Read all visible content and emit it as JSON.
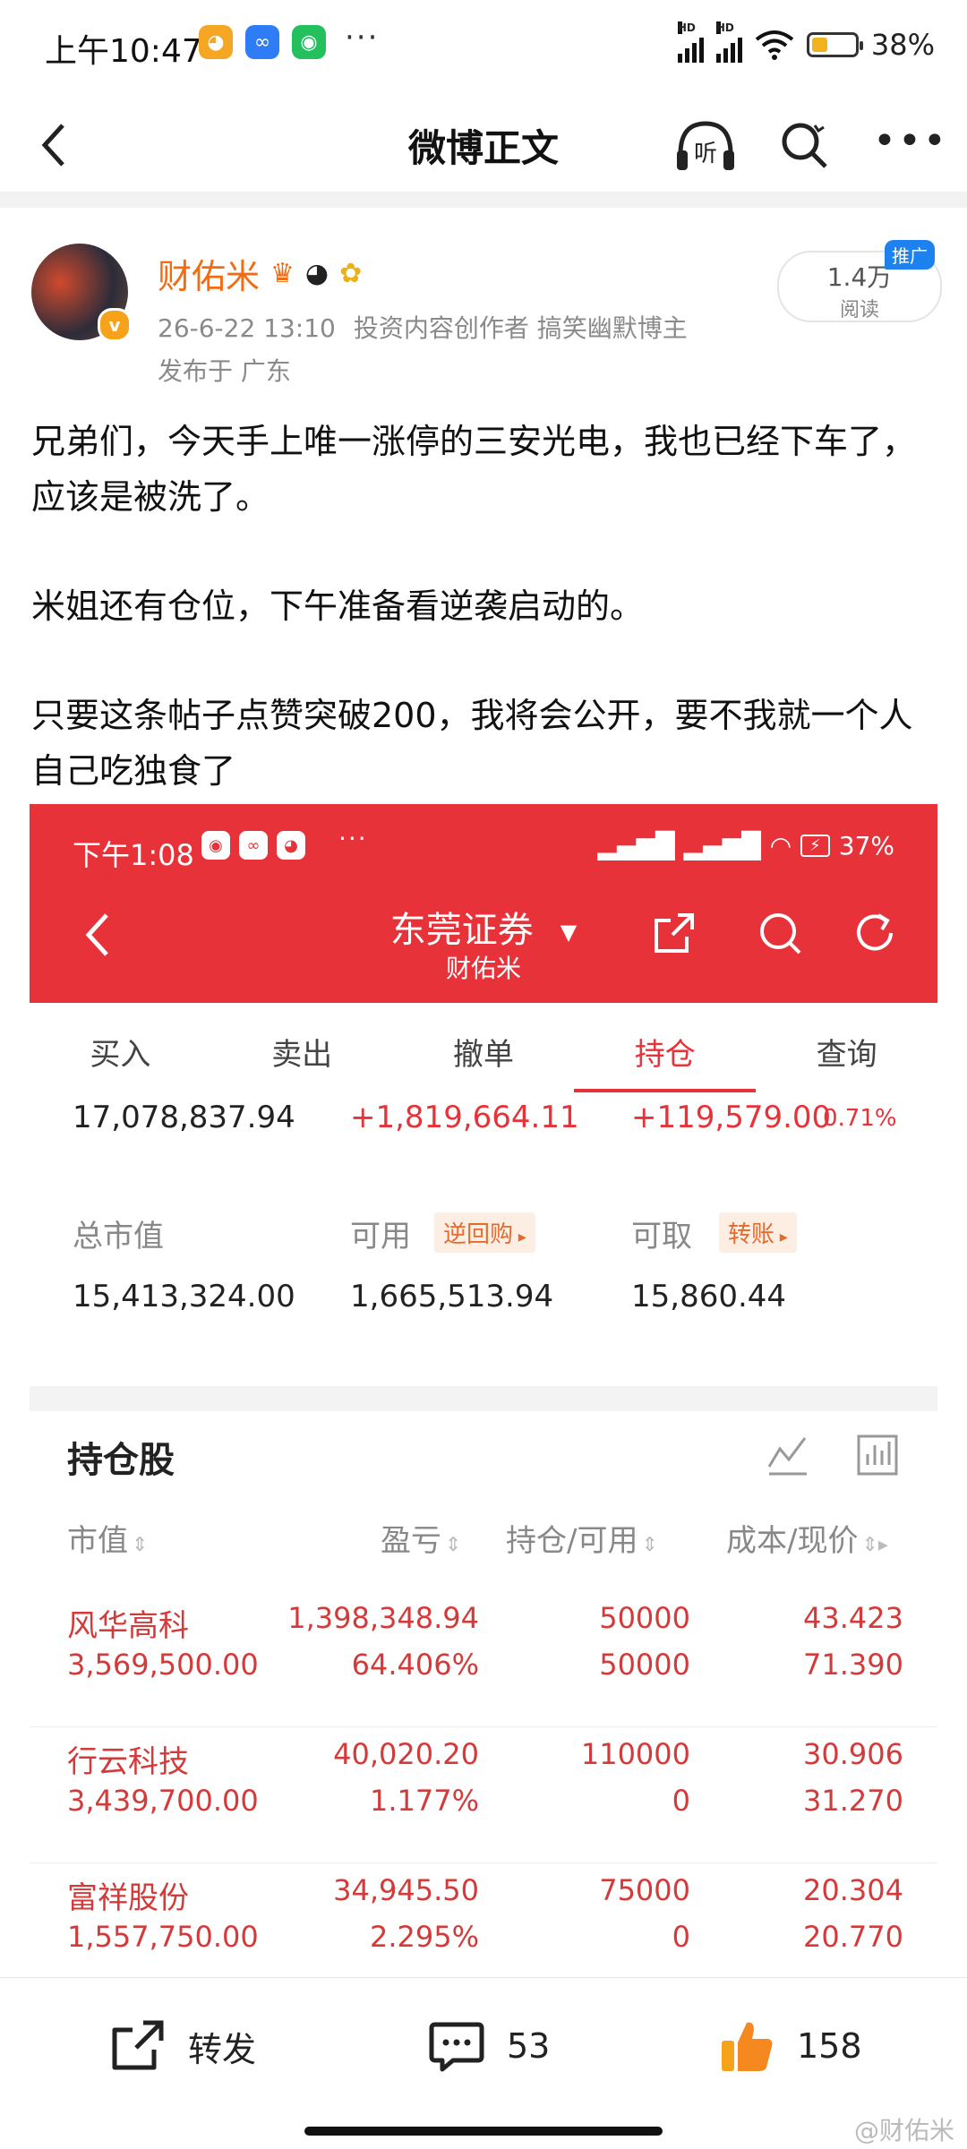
{
  "status_bar": {
    "time": "上午10:47",
    "more": "···",
    "battery": "38%",
    "battery_level": 0.38
  },
  "nav": {
    "title": "微博正文",
    "listen_label": "听"
  },
  "post": {
    "username": "财佑米",
    "meta": "26-6-22 13:10",
    "tags": "投资内容创作者 搞笑幽默博主",
    "location": "发布于 广东",
    "read_count": "1.4万",
    "read_label": "阅读",
    "promo": "推广",
    "paragraphs": [
      "兄弟们，今天手上唯一涨停的三安光电，我也已经下车了，应该是被洗了。",
      "米姐还有仓位，下午准备看逆袭启动的。",
      "只要这条帖子点赞突破200，我将会公开，要不我就一个人自己吃独食了"
    ]
  },
  "screenshot": {
    "time": "下午1:08",
    "more": "···",
    "battery": "37%",
    "brand": "东莞证券",
    "account": "财佑米",
    "tabs": [
      "买入",
      "卖出",
      "撤单",
      "持仓",
      "查询"
    ],
    "active_tab": 3,
    "summary_row": {
      "total": "17,078,837.94",
      "pnl": "+1,819,664.11",
      "day_pnl": "+119,579.00",
      "day_pct": "0.71%"
    },
    "labels": {
      "market_value": "总市值",
      "available": "可用",
      "reverse_repo": "逆回购",
      "withdrawable": "可取",
      "transfer": "转账"
    },
    "values": {
      "market_value": "15,413,324.00",
      "available": "1,665,513.94",
      "withdrawable": "15,860.44"
    },
    "holdings_title": "持仓股",
    "columns": [
      "市值",
      "盈亏",
      "持仓/可用",
      "成本/现价"
    ],
    "holdings": [
      {
        "name": "风华高科",
        "value": "3,569,500.00",
        "pnl": "1,398,348.94",
        "pnl_pct": "64.406%",
        "hold": "50000",
        "avail": "50000",
        "cost": "43.423",
        "price": "71.390"
      },
      {
        "name": "行云科技",
        "value": "3,439,700.00",
        "pnl": "40,020.20",
        "pnl_pct": "1.177%",
        "hold": "110000",
        "avail": "0",
        "cost": "30.906",
        "price": "31.270"
      },
      {
        "name": "富祥股份",
        "value": "1,557,750.00",
        "pnl": "34,945.50",
        "pnl_pct": "2.295%",
        "hold": "75000",
        "avail": "0",
        "cost": "20.304",
        "price": "20.770"
      }
    ]
  },
  "toolbar": {
    "repost": "转发",
    "comments": "53",
    "likes": "158"
  },
  "watermark": "@财佑米",
  "colors": {
    "accent_orange": "#f46c12",
    "broker_red": "#e8323a",
    "stock_red": "#d43a3a"
  }
}
